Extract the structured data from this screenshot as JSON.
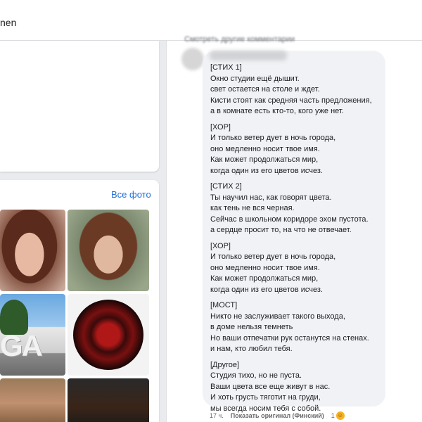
{
  "topbar": {
    "name": "nen"
  },
  "photos": {
    "all_photos_label": "Все фото",
    "p3_letters": "GA"
  },
  "comments": {
    "more_label": "Смотреть другие комментарии"
  },
  "comment": {
    "stanzas": [
      [
        "[СТИХ 1]",
        "Окно студии ещё дышит.",
        "свет остается на столе и ждет.",
        "Кисти стоят как средняя часть предложения,",
        "а в комнате есть кто-то, кого уже нет."
      ],
      [
        "[ХОР]",
        "И только ветер дует в ночь города,",
        "оно медленно носит твое имя.",
        "Как может продолжаться мир,",
        "когда один из его цветов исчез."
      ],
      [
        "[СТИХ 2]",
        "Ты научил нас, как говорят цвета.",
        "как тень не вся черная.",
        "Сейчас в школьном коридоре эхом пустота.",
        "а сердце просит то, на что не отвечает."
      ],
      [
        "[ХОР]",
        "И только ветер дует в ночь города,",
        "оно медленно носит твое имя.",
        "Как может продолжаться мир,",
        "когда один из его цветов исчез."
      ],
      [
        "[МОСТ]",
        "Никто не заслуживает такого выхода,",
        "в доме нельзя темнеть",
        "Но ваши отпечатки рук останутся на стенах.",
        "и нам, кто любил тебя."
      ],
      [
        "[Другое]",
        "Студия тихо, но не пуста.",
        "Ваши цвета все еще живут в нас.",
        "И хоть грусть тяготит на груди,",
        "мы всегда носим тебя с собой."
      ]
    ],
    "time": "17 ч.",
    "show_original": "Показать оригинал (Финский)",
    "reaction_count": "1"
  },
  "colors": {
    "link": "#216fdb",
    "bubble": "#f0f2f5",
    "muted": "#65676b"
  }
}
